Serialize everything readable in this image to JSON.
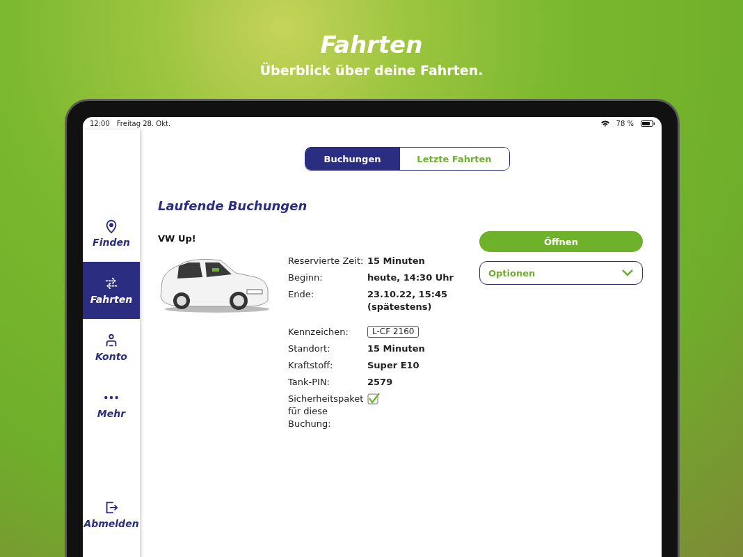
{
  "header": {
    "title": "Fahrten",
    "subtitle": "Überblick über deine Fahrten."
  },
  "status_bar": {
    "time": "12:00",
    "date": "Freitag 28. Okt.",
    "battery": "78 %"
  },
  "sidebar": {
    "items": [
      {
        "label": "Finden",
        "selected": false
      },
      {
        "label": "Fahrten",
        "selected": true
      },
      {
        "label": "Konto",
        "selected": false
      },
      {
        "label": "Mehr",
        "selected": false
      }
    ],
    "logout": "Abmelden"
  },
  "segments": [
    {
      "label": "Buchungen",
      "selected": true
    },
    {
      "label": "Letzte Fahrten",
      "selected": false
    }
  ],
  "section_title": "Laufende Buchungen",
  "vehicle": {
    "name": "VW Up!"
  },
  "details": [
    {
      "kind": "text",
      "label": "Reservierte Zeit:",
      "value": "15 Minuten"
    },
    {
      "kind": "text",
      "label": "Beginn:",
      "value": "heute, 14:30 Uhr"
    },
    {
      "kind": "text",
      "label": "Ende:",
      "value": "23.10.22, 15:45 (spätestens)"
    },
    {
      "kind": "plate",
      "label": "Kennzeichen:",
      "value": "L-CF 2160"
    },
    {
      "kind": "text",
      "label": "Standort:",
      "value": "15 Minuten"
    },
    {
      "kind": "text",
      "label": "Kraftstoff:",
      "value": "Super E10"
    },
    {
      "kind": "text",
      "label": "Tank-PIN:",
      "value": "2579"
    },
    {
      "kind": "check",
      "label": "Sicherheitspaket für diese Buchung:",
      "checked": true
    }
  ],
  "actions": {
    "open": "Öffnen",
    "options": "Optionen"
  }
}
